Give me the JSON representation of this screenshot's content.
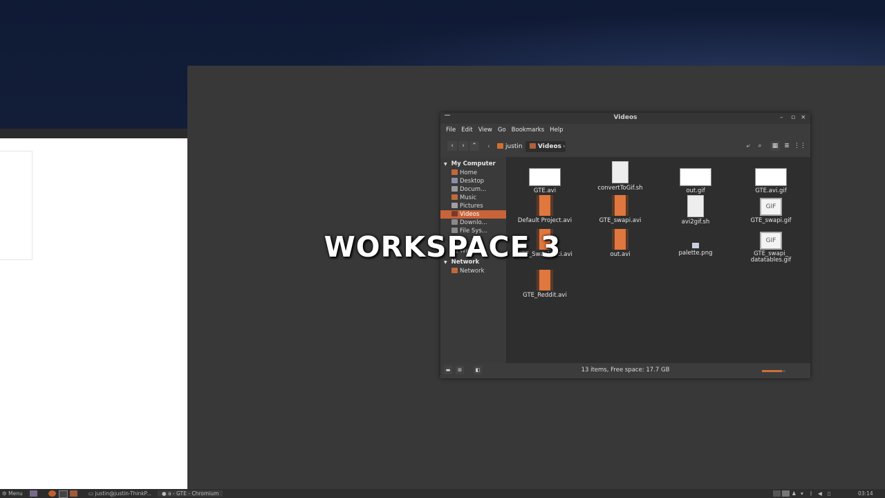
{
  "file_manager": {
    "title": "Videos",
    "menu": [
      "File",
      "Edit",
      "View",
      "Go",
      "Bookmarks",
      "Help"
    ],
    "breadcrumb": [
      {
        "label": "justin",
        "icon": "home-folder-icon"
      },
      {
        "label": "Videos",
        "icon": "videos-folder-icon",
        "active": true
      }
    ],
    "sidebar": {
      "sections": [
        {
          "header": "My Computer",
          "items": [
            {
              "label": "Home"
            },
            {
              "label": "Desktop"
            },
            {
              "label": "Docum..."
            },
            {
              "label": "Music"
            },
            {
              "label": "Pictures"
            },
            {
              "label": "Videos",
              "selected": true
            },
            {
              "label": "Downlo..."
            },
            {
              "label": "File Sys..."
            },
            {
              "label": ""
            },
            {
              "label": "Window..."
            }
          ]
        },
        {
          "header": "Network",
          "items": [
            {
              "label": "Network"
            }
          ]
        }
      ]
    },
    "items": [
      {
        "name": "GTE.avi",
        "kind": "video-thumb"
      },
      {
        "name": "convertToGif.sh",
        "kind": "doc"
      },
      {
        "name": "out.gif",
        "kind": "video-thumb"
      },
      {
        "name": "GTE.avi.gif",
        "kind": "video-thumb"
      },
      {
        "name": "Default Project.avi",
        "kind": "film"
      },
      {
        "name": "GTE_swapi.avi",
        "kind": "film"
      },
      {
        "name": "avi2gif.sh",
        "kind": "doc"
      },
      {
        "name": "GTE_swapi.gif",
        "kind": "gif"
      },
      {
        "name": "GTE_Swapi_...ti.avi",
        "kind": "film"
      },
      {
        "name": "out.avi",
        "kind": "film"
      },
      {
        "name": "palette.png",
        "kind": "png"
      },
      {
        "name": "GTE_swapi_\ndatatables.gif",
        "kind": "gif"
      },
      {
        "name": "GTE_Reddit.avi",
        "kind": "film"
      }
    ],
    "gif_label": "GIF",
    "status": "13 items, Free space: 17.7 GB",
    "zoom_fraction": 0.85
  },
  "overlay": {
    "text": "WORKSPACE 3"
  },
  "taskbar": {
    "menu_label": "Menu",
    "terminal_label": "justin@justin-ThinkP...",
    "browser_label": "a - GTE - Chromium",
    "clock": "03:14"
  },
  "colors": {
    "accent": "#c9643a",
    "window_bg": "#3c3c3c",
    "content_bg": "#2e2e2e"
  }
}
